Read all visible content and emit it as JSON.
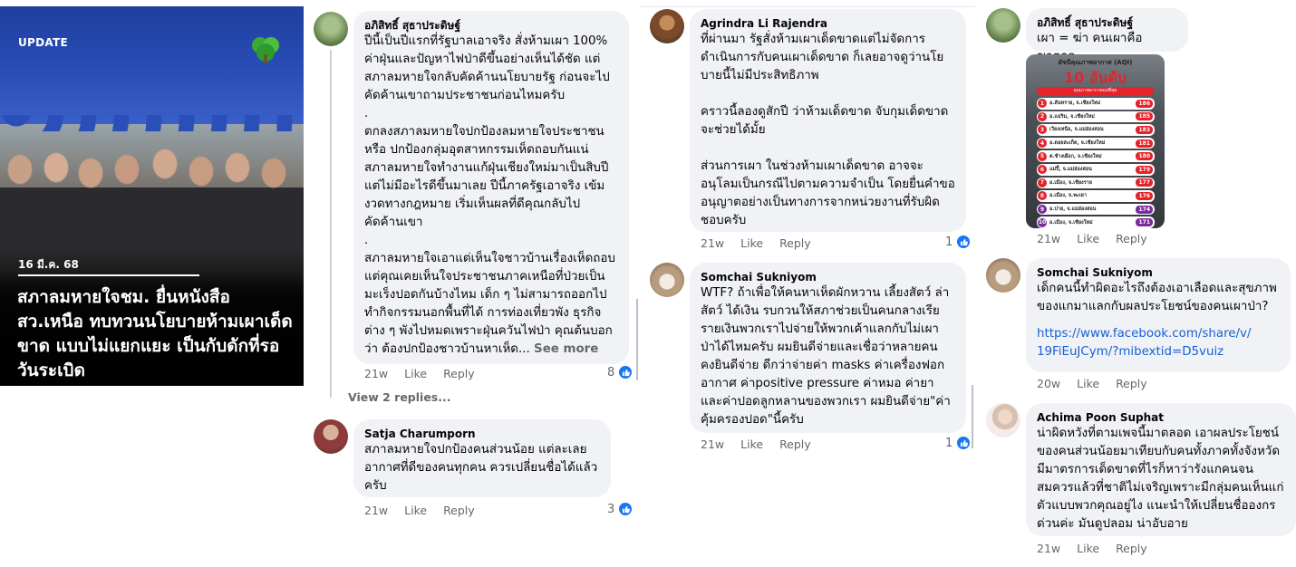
{
  "news_card": {
    "tag": "UPDATE",
    "date": "16 มี.ค. 68",
    "headline": "สภาลมหายใจชม. ยื่นหนังสือ สว.เหนือ ทบทวนนโยบายห้ามเผาเด็ดขาด แบบไม่แยกแยะ เป็นกับดักที่รอวันระเบิด"
  },
  "comments_col1": [
    {
      "author": "อภิสิทธิ์ สุธาประดิษฐ์",
      "text": "ปีนี้เป็นปีแรกที่รัฐบาลเอาจริง สั่งห้ามเผา 100%\nค่าฝุ่นและปัญหาไฟป่าดีขึ้นอย่างเห็นได้ชัด แต่\nสภาลมหายใจกลับคัดค้านนโยบายรัฐ ก่อนจะไป\nคัดค้านเขาถามประชาชนก่อนไหมครับ\n.\nตกลงสภาลมหายใจปกป้องลมหายใจประชาชน\nหรือ ปกป้องกลุ่มอุตสาหกรรมเห็ดถอบกันแน่\nสภาลมหายใจทำงานแก้ฝุ่นเชียงใหม่มาเป็นสิบปี\nแต่ไม่มีอะไรดีขึ้นมาเลย ปีนี้ภาครัฐเอาจริง เข้ม\nงวดทางกฎหมาย เริ่มเห็นผลที่ดีคุณกลับไป\nคัดค้านเขา\n.\nสภาลมหายใจเอาแต่เห็นใจชาวบ้านเรื่องเห็ดถอบ\nแต่คุณเคยเห็นใจประชาชนภาคเหนือที่ป่วยเป็น\nมะเร็งปอดกันบ้างไหม เด็ก ๆ ไม่สามารถออกไป\nทำกิจกรรมนอกพื้นที่ได้ การท่องเที่ยวพัง ธุรกิจ\nต่าง ๆ พังไปหมดเพราะฝุ่นควันไฟป่า คุณต้นบอก\nว่า ต้องปกป้องชาวบ้านหาเห็ด...",
      "see_more": "See more",
      "time": "21w",
      "like": "Like",
      "reply": "Reply",
      "reactions": "8",
      "view_replies": "View 2 replies..."
    },
    {
      "author": "Satja Charumporn",
      "text": "สภาลมหายใจปกป้องคนส่วนน้อย แต่ละเลย\nอากาศที่ดีของคนทุกคน ควรเปลี่ยนชื่อได้แล้ว\nครับ",
      "time": "21w",
      "like": "Like",
      "reply": "Reply",
      "reactions": "3"
    }
  ],
  "comments_col2": [
    {
      "author": "Agrindra Li Rajendra",
      "text": "ที่ผ่านมา รัฐสั่งห้ามเผาเด็ดขาดแต่ไม่จัดการ\nดำเนินการกับคนเผาเด็ดขาด ก็เลยอาจดูว่านโย\nบายนี้ไม่มีประสิทธิภาพ\n\nคราวนี้ลองดูสักปี ว่าห้ามเด็ดขาด จับกุมเด็ดขาด\nจะช่วยได้มั้ย\n\nส่วนการเผา ในช่วงห้ามเผาเด็ดขาด อาจจะ\nอนุโลมเป็นกรณีไปตามความจำเป็น โดยยื่นคำขอ\nอนุญาตอย่างเป็นทางการจากหน่วยงานที่รับผิด\nชอบครับ",
      "time": "21w",
      "like": "Like",
      "reply": "Reply",
      "reactions": "1"
    },
    {
      "author": "Somchai Sukniyom",
      "text": "WTF? ถ้าเพื่อให้คนหาเห็ดผักหวาน เลี้ยงสัตว์ ล่า\nสัตว์ ได้เงิน รบกวนให้สภาช่วยเป็นคนกลางเรีย\nรายเงินพวกเราไปจ่ายให้พวกเค้าแลกกับไม่เผา\nป่าได้ไหมครับ  ผมยินดีจ่ายและเชื่อว่าหลายคน\nคงยินดีจ่าย ดีกว่าจ่ายค่า masks ค่าเครื่องฟอก\nอากาศ ค่าpositive pressure ค่าหมอ ค่ายา\nและค่าปอดลูกหลานของพวกเรา ผมยินดีจ่าย\"ค่า\nคุ้มครองปอด\"นี้ครับ",
      "time": "21w",
      "like": "Like",
      "reply": "Reply",
      "reactions": "1"
    }
  ],
  "comments_col3": [
    {
      "author": "อภิสิทธิ์ สุธาประดิษฐ์",
      "text": "เผา = ฆ่า คนเผาคือฆาตกร",
      "time": "21w",
      "like": "Like",
      "reply": "Reply"
    },
    {
      "author": "Somchai Sukniyom",
      "text": "เด็กคนนี้ทำผิดอะไรถึงต้องเอาเลือดและสุขภาพ\nของแกมาแลกกับผลประโยชน์ของคนเผาป่า?",
      "link": "https://www.facebook.com/share/v/\n19FiEuJCym/?mibextid=D5vuiz",
      "time": "20w",
      "like": "Like",
      "reply": "Reply"
    },
    {
      "author": "Achima Poon Suphat",
      "text": "น่าผิดหวังที่ตามเพจนี้มาตลอด เอาผลประโยชน์\nของคนส่วนน้อยมาเทียบกับคนทั้งภาคทั้งจังหวัด\nมีมาตรการเด็ดขาดที่ไรก็หาว่ารังแกคนจน\nสมควรแล้วที่ชาติไม่เจริญเพราะมีกลุ่มคนเห็นแก่\nตัวแบบพวกคุณอยู่ไง แนะนำให้เปลี่ยนชื่อองกร\nด่วนค่ะ มันดูปลอม น่าอับอาย",
      "time": "21w",
      "like": "Like",
      "reply": "Reply"
    }
  ],
  "aqi_image": {
    "title": "ดัชนีคุณภาพอากาศ (AQI)",
    "big": "10 อันดับ",
    "sub": "คุณภาพอากาศแย่ที่สุด",
    "rows": [
      {
        "n": "1",
        "place": "อ.สันทราย, จ.เชียงใหม่",
        "value": "186"
      },
      {
        "n": "2",
        "place": "อ.แม่ริม, จ.เชียงใหม่",
        "value": "185"
      },
      {
        "n": "3",
        "place": "เวียงเหนือ, จ.แม่ฮ่องสอน",
        "value": "183"
      },
      {
        "n": "4",
        "place": "อ.ดอยสะเก็ด, จ.เชียงใหม่",
        "value": "181"
      },
      {
        "n": "5",
        "place": "ต.ช้างเผือก, จ.เชียงใหม่",
        "value": "180"
      },
      {
        "n": "6",
        "place": "แม่ปี้, จ.แม่ฮ่องสอน",
        "value": "179"
      },
      {
        "n": "7",
        "place": "อ.เมือง, จ.เชียงราย",
        "value": "177"
      },
      {
        "n": "8",
        "place": "อ.เมือง, จ.พะเยา",
        "value": "176"
      },
      {
        "n": "9",
        "place": "อ.ปาย, จ.แม่ฮ่องสอน",
        "value": "174"
      },
      {
        "n": "10",
        "place": "อ.เมือง, จ.เชียงใหม่",
        "value": "171"
      }
    ]
  },
  "colors": {
    "bubble": "#f0f2f5",
    "meta": "#65676b",
    "link": "#1861d6",
    "reaction": "#1877f2"
  }
}
